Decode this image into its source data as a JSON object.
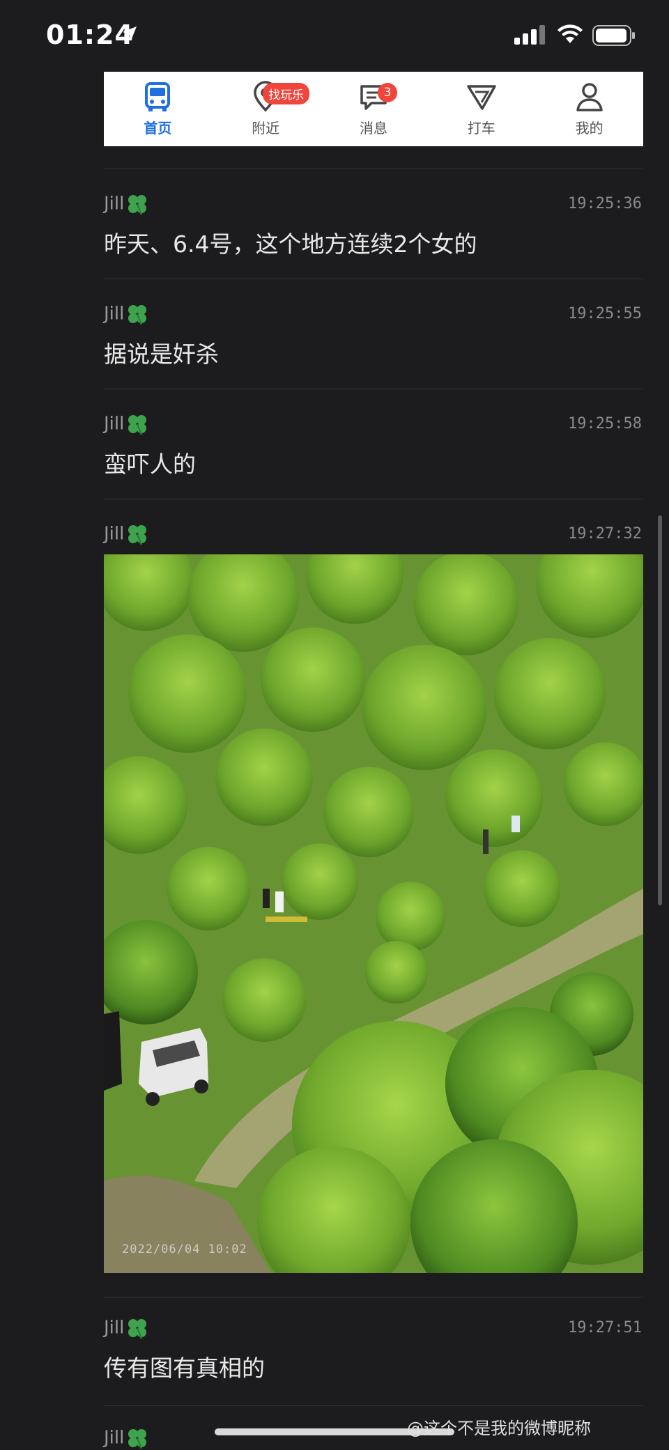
{
  "status_bar": {
    "time": "01:24"
  },
  "tab_bar": {
    "tabs": [
      {
        "label": "首页",
        "icon": "bus-icon",
        "active": true
      },
      {
        "label": "附近",
        "icon": "location-pin-icon",
        "badge": "找玩乐"
      },
      {
        "label": "消息",
        "icon": "message-icon",
        "badge": "3"
      },
      {
        "label": "打车",
        "icon": "taxi-arrow-icon"
      },
      {
        "label": "我的",
        "icon": "user-icon"
      }
    ],
    "active_color": "#1f6fe0",
    "badge_color": "#f0453a"
  },
  "messages": [
    {
      "sender": "Jill",
      "time": "19:25:36",
      "text": "昨天、6.4号，这个地方连续2个女的"
    },
    {
      "sender": "Jill",
      "time": "19:25:55",
      "text": "据说是奸杀"
    },
    {
      "sender": "Jill",
      "time": "19:25:58",
      "text": "蛮吓人的"
    },
    {
      "sender": "Jill",
      "time": "19:27:32",
      "image": {
        "date_stamp": "2022/06/04 10:02"
      }
    },
    {
      "sender": "Jill",
      "time": "19:27:51",
      "text": "传有图有真相的"
    },
    {
      "sender": "Jill"
    }
  ],
  "watermark": "@这个不是我的微博昵称"
}
